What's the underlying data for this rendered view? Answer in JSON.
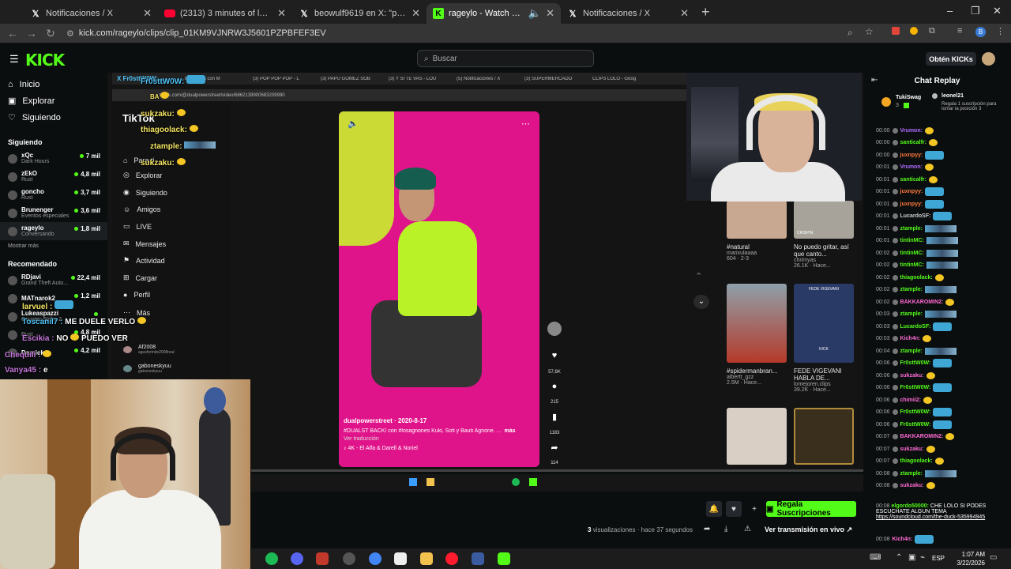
{
  "browser": {
    "tabs": [
      {
        "icon": "x",
        "title": "Notificaciones / X"
      },
      {
        "icon": "youtube",
        "title": "(2313) 3 minutes of leo messi a"
      },
      {
        "icon": "x",
        "title": "beowulf9619 en X: \"pobre mar"
      },
      {
        "icon": "kick",
        "title": "rageylo - Watch clips on Ki"
      },
      {
        "icon": "x",
        "title": "Notificaciones / X"
      }
    ],
    "url": "kick.com/rageylo/clips/clip_01KM9VJNRW3J5601PZPBFEF3EV"
  },
  "kick": {
    "logo": "KICK",
    "search_placeholder": "Buscar",
    "get_kicks": "Obtén KICKs",
    "nav": [
      {
        "label": "Inicio"
      },
      {
        "label": "Explorar"
      },
      {
        "label": "Siguiendo"
      }
    ],
    "following_title": "Siguiendo",
    "following": [
      {
        "name": "xQc",
        "game": "Dark Hours",
        "viewers": "7 mil"
      },
      {
        "name": "zEkO",
        "game": "Rust",
        "viewers": "4,8 mil"
      },
      {
        "name": "goncho",
        "game": "Rust",
        "viewers": "3,7 mil"
      },
      {
        "name": "Brunenger",
        "game": "Eventos especiales",
        "viewers": "3,6 mil"
      },
      {
        "name": "rageylo",
        "game": "Conversando",
        "viewers": "1,8 mil"
      }
    ],
    "show_more": "Mostrar más",
    "recommended_title": "Recomendado",
    "recommended": [
      {
        "name": "RDjavi",
        "game": "Grand Theft Auto...",
        "viewers": "22,4 mil"
      },
      {
        "name": "MATnarok2",
        "game": "",
        "viewers": "1,2 mil"
      },
      {
        "name": "Lukeaspazzi",
        "game": "Counter-Strike 2",
        "viewers": ""
      },
      {
        "name": "",
        "game": "Rust",
        "viewers": "4,8 mil"
      },
      {
        "name": "Daarick",
        "game": "",
        "viewers": "4,2 mil"
      }
    ]
  },
  "stream_overlay": {
    "inner_tabs": [
      "X  Fr0sttW0W:",
      "Entrevista con M",
      "(3) POP POP POP - L",
      "(3) PAPU GÓMEZ SOB",
      "(3) Y SI TE VAS - LOU",
      "(5) Notificaciones / X",
      "(3) SUPERMERCADO",
      "CLIPS LOLO - Goog"
    ],
    "inner_url": "tiktok.com/@dualpowerstreet/video/6862139900683209990",
    "tiktok_logo": "TikTok",
    "tiktok_nav": [
      "Para ti",
      "Explorar",
      "Siguiendo",
      "Amigos",
      "LIVE",
      "Mensajes",
      "Actividad",
      "Cargar",
      "Perfil",
      "Más"
    ],
    "tiktok_following": [
      {
        "name": "Af2008",
        "sub": "agusfortnite2008real"
      },
      {
        "name": "gaboneskyuu",
        "sub": "gaboneskyuu"
      }
    ],
    "overlay_chat": [
      {
        "user": "Fr0sttW0W:",
        "color": "#4fc3f7",
        "text": ""
      },
      {
        "user": "sukzaku:",
        "color": "#f5e663",
        "text": ""
      },
      {
        "user": "thiagoolack:",
        "color": "#f5e663",
        "text": ""
      },
      {
        "user": "ztample:",
        "color": "#f5e663",
        "text": ""
      },
      {
        "user": "sukzaku:",
        "color": "#f5e663",
        "text": ""
      },
      {
        "user": "larvuel :",
        "color": "#f5e663",
        "text": ""
      },
      {
        "user": "Toscanil7 :",
        "color": "#4fc3f7",
        "text": "ME DUELE VERLO"
      },
      {
        "user": "Escikia :",
        "color": "#c678dd",
        "text": "NO",
        "text2": "PUEDO VER"
      },
      {
        "user": "Chequili :",
        "color": "#c678dd",
        "text": ""
      },
      {
        "user": "Vanya45 :",
        "color": "#c678dd",
        "text": "e"
      }
    ],
    "video": {
      "author": "dualpowerstreet · 2020-8-17",
      "caption": "#DUALST BACK! con #losagnones Kuki, Sofi y Bauti Agnone. ...",
      "more": "más",
      "translate": "Ver traducción",
      "music": "4K - El Alfa & Darell & Noriel",
      "likes": "57,6K",
      "comments": "215",
      "saves": "1183",
      "shares": "114"
    },
    "recs": [
      {
        "title": "#natural",
        "user": "marixulaaaa",
        "meta": "604 · 2-3"
      },
      {
        "title": "No puedo gritar, así que canto...",
        "user": "chrimyas",
        "meta": "26.1K · Hace..."
      },
      {
        "title": "#spidermanbran...",
        "user": "albertt_gzz",
        "meta": "2.5M · Hace..."
      },
      {
        "title": "FEDE VIGEVANI HABLA DE...",
        "user": "lomejoren.clips",
        "meta": "39.2K · Hace..."
      }
    ],
    "rec_thumb_text": [
      "CRISPIN",
      "FEDE VIGEVANI",
      "KICK"
    ]
  },
  "clip_actions": {
    "gift_subs": "Regala Suscripciones",
    "views_count": "3",
    "views_label": "visualizaciones",
    "time_ago": "· hace 37 segundos",
    "watch_live": "Ver transmisión en vivo"
  },
  "chat": {
    "header": "Chat Replay",
    "pinned": {
      "user": "TukiSwag",
      "count": "3",
      "gifter": "leonel21",
      "text": "Regala 1 suscripción para tomar la posición 3",
      "count2": "3"
    },
    "messages": [
      {
        "time": "00:00",
        "user": "Vrumon:",
        "color": "#b06cff",
        "emote": "yellow"
      },
      {
        "time": "00:00",
        "user": "santicalfr:",
        "color": "#53fc18",
        "emote": "yellow"
      },
      {
        "time": "00:00",
        "user": "juxnpyy:",
        "color": "#ff7a3d",
        "emote": "cat"
      },
      {
        "time": "00:01",
        "user": "Vrumon:",
        "color": "#b06cff",
        "emote": "yellow"
      },
      {
        "time": "00:01",
        "user": "santicalfr:",
        "color": "#53fc18",
        "emote": "yellow"
      },
      {
        "time": "00:01",
        "user": "juxnpyy:",
        "color": "#ff7a3d",
        "emote": "cat"
      },
      {
        "time": "00:01",
        "user": "juxnpyy:",
        "color": "#ff7a3d",
        "emote": "cat"
      },
      {
        "time": "00:01",
        "user": "LucardoSF:",
        "color": "#cccccc",
        "emote": "cat"
      },
      {
        "time": "00:01",
        "user": "ztample:",
        "color": "#53fc18",
        "emote": "wide"
      },
      {
        "time": "00:01",
        "user": "tintinMC:",
        "color": "#53fc18",
        "emote": "wide"
      },
      {
        "time": "00:02",
        "user": "tintinMC:",
        "color": "#53fc18",
        "emote": "wide"
      },
      {
        "time": "00:02",
        "user": "tintinMC:",
        "color": "#53fc18",
        "emote": "wide"
      },
      {
        "time": "00:02",
        "user": "thiagoolack:",
        "color": "#53fc18",
        "emote": "yellow"
      },
      {
        "time": "00:02",
        "user": "ztample:",
        "color": "#53fc18",
        "emote": "wide"
      },
      {
        "time": "00:02",
        "user": "BAKKAROMIN2:",
        "color": "#ff6ad5",
        "emote": "yellow"
      },
      {
        "time": "00:03",
        "user": "ztample:",
        "color": "#53fc18",
        "emote": "wide"
      },
      {
        "time": "00:03",
        "user": "LucardoSF:",
        "color": "#53fc18",
        "emote": "cat"
      },
      {
        "time": "00:03",
        "user": "Kich4n:",
        "color": "#ff6ad5",
        "emote": "yellow"
      },
      {
        "time": "00:04",
        "user": "ztample:",
        "color": "#53fc18",
        "emote": "wide"
      },
      {
        "time": "00:06",
        "user": "Fr0sttW0W:",
        "color": "#53fc18",
        "emote": "cat"
      },
      {
        "time": "00:06",
        "user": "sukzaku:",
        "color": "#ff6ad5",
        "emote": "yellow"
      },
      {
        "time": "00:06",
        "user": "Fr0sttW0W:",
        "color": "#53fc18",
        "emote": "cat"
      },
      {
        "time": "00:06",
        "user": "chimii2:",
        "color": "#ff6ad5",
        "emote": "yellow"
      },
      {
        "time": "00:06",
        "user": "Fr0sttW0W:",
        "color": "#53fc18",
        "emote": "cat"
      },
      {
        "time": "00:06",
        "user": "Fr0sttW0W:",
        "color": "#53fc18",
        "emote": "cat"
      },
      {
        "time": "00:07",
        "user": "BAKKAROMIN2:",
        "color": "#ff6ad5",
        "emote": "yellow"
      },
      {
        "time": "00:07",
        "user": "sukzaku:",
        "color": "#ff6ad5",
        "emote": "yellow"
      },
      {
        "time": "00:07",
        "user": "thiagoolack:",
        "color": "#53fc18",
        "emote": "yellow"
      },
      {
        "time": "00:08",
        "user": "ztample:",
        "color": "#53fc18",
        "emote": "wide"
      },
      {
        "time": "00:08",
        "user": "sukzaku:",
        "color": "#ff6ad5",
        "emote": "yellow"
      }
    ],
    "long_msg": {
      "time": "00:08",
      "user": "elgordo50000:",
      "color": "#53fc18",
      "text": "CHE LOLO SI PODES ESCUCHATE ALGUN TEMA",
      "link": "https://soundcloud.com/the-duck-535994945"
    },
    "last_msg": {
      "time": "00:08",
      "user": "Kich4n:",
      "color": "#ff6ad5"
    }
  },
  "taskbar": {
    "lang": "ESP",
    "time": "1:07 AM",
    "date": "3/22/2026"
  },
  "colors": {
    "kick_green": "#53fc18",
    "bg": "#0b0e0f"
  }
}
